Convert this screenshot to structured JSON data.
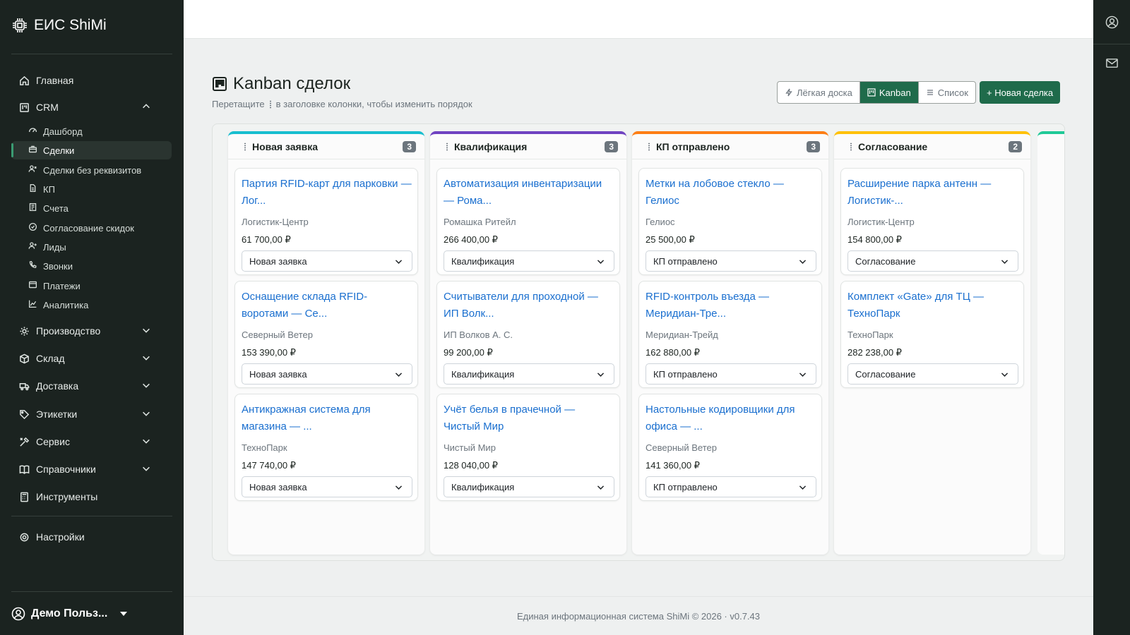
{
  "brand": {
    "name": "ЕИС ShiMi",
    "icon": "cpu-chip-icon"
  },
  "sidebar": {
    "items": [
      {
        "label": "Главная",
        "icon": "home-icon"
      },
      {
        "label": "CRM",
        "icon": "kanban-icon",
        "expanded": true
      },
      {
        "label": "Производство",
        "icon": "gear-icon"
      },
      {
        "label": "Склад",
        "icon": "box-icon"
      },
      {
        "label": "Доставка",
        "icon": "truck-icon"
      },
      {
        "label": "Этикетки",
        "icon": "tag-icon"
      },
      {
        "label": "Сервис",
        "icon": "tools-icon"
      },
      {
        "label": "Справочники",
        "icon": "book-icon"
      },
      {
        "label": "Инструменты",
        "icon": "calculator-icon"
      },
      {
        "label": "Настройки",
        "icon": "settings-icon"
      }
    ],
    "crm_sub": [
      {
        "label": "Дашборд",
        "icon": "speedometer-icon"
      },
      {
        "label": "Сделки",
        "icon": "briefcase-icon",
        "active": true
      },
      {
        "label": "Сделки без реквизитов",
        "icon": "people-icon"
      },
      {
        "label": "КП",
        "icon": "file-icon"
      },
      {
        "label": "Счета",
        "icon": "receipt-icon"
      },
      {
        "label": "Согласование скидок",
        "icon": "check-circle-icon"
      },
      {
        "label": "Лиды",
        "icon": "person-plus-icon"
      },
      {
        "label": "Звонки",
        "icon": "phone-icon"
      },
      {
        "label": "Платежи",
        "icon": "wallet-icon"
      },
      {
        "label": "Аналитика",
        "icon": "graph-icon"
      }
    ],
    "user": "Демо Польз..."
  },
  "header": {
    "title": "Kanban сделок",
    "hint_before": "Перетащите",
    "hint_after": "в заголовке колонки, чтобы изменить порядок",
    "views": [
      "Лёгкая доска",
      "Kanban",
      "Список"
    ],
    "active_view": "Kanban",
    "new_deal": "+ Новая сделка"
  },
  "colors": {
    "accent": "#1f6b4b",
    "link": "#1a6fcf",
    "sidebar": "#1b2320"
  },
  "columns": [
    {
      "title": "Новая заявка",
      "count": "3",
      "color": "#17becf",
      "cards": [
        {
          "title": "Партия RFID-карт для парковки — Лог...",
          "client": "Логистик-Центр",
          "amount": "61 700,00 ₽",
          "stage": "Новая заявка"
        },
        {
          "title": "Оснащение склада RFID-воротами — Се...",
          "client": "Северный Ветер",
          "amount": "153 390,00 ₽",
          "stage": "Новая заявка"
        },
        {
          "title": "Антикражная система для магазина — ...",
          "client": "ТехноПарк",
          "amount": "147 740,00 ₽",
          "stage": "Новая заявка"
        }
      ]
    },
    {
      "title": "Квалификация",
      "count": "3",
      "color": "#6f42c1",
      "cards": [
        {
          "title": "Автоматизация инвентаризации — Рома...",
          "client": "Ромашка Ритейл",
          "amount": "266 400,00 ₽",
          "stage": "Квалификация"
        },
        {
          "title": "Считыватели для проходной — ИП Волк...",
          "client": "ИП Волков А. С.",
          "amount": "99 200,00 ₽",
          "stage": "Квалификация"
        },
        {
          "title": "Учёт белья в прачечной — Чистый Мир",
          "client": "Чистый Мир",
          "amount": "128 040,00 ₽",
          "stage": "Квалификация"
        }
      ]
    },
    {
      "title": "КП отправлено",
      "count": "3",
      "color": "#fd7e14",
      "cards": [
        {
          "title": "Метки на лобовое стекло — Гелиос",
          "client": "Гелиос",
          "amount": "25 500,00 ₽",
          "stage": "КП отправлено"
        },
        {
          "title": "RFID-контроль въезда — Меридиан-Тре...",
          "client": "Меридиан-Трейд",
          "amount": "162 880,00 ₽",
          "stage": "КП отправлено"
        },
        {
          "title": "Настольные кодировщики для офиса — ...",
          "client": "Северный Ветер",
          "amount": "141 360,00 ₽",
          "stage": "КП отправлено"
        }
      ]
    },
    {
      "title": "Согласование",
      "count": "2",
      "color": "#ffc107",
      "cards": [
        {
          "title": "Расширение парка антенн — Логистик-...",
          "client": "Логистик-Центр",
          "amount": "154 800,00 ₽",
          "stage": "Согласование"
        },
        {
          "title": "Комплект «Gate» для ТЦ — ТехноПарк",
          "client": "ТехноПарк",
          "amount": "282 238,00 ₽",
          "stage": "Согласование"
        }
      ]
    }
  ],
  "footer": "Единая информационная система ShiMi © 2026 · v0.7.43"
}
